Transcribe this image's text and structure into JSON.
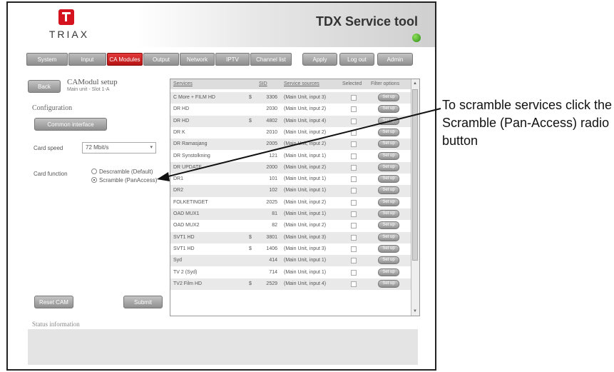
{
  "header": {
    "logo_text": "TRIAX",
    "title": "TDX Service tool"
  },
  "nav": {
    "tabs": [
      {
        "label": "System"
      },
      {
        "label": "Input"
      },
      {
        "label": "CA Modules"
      },
      {
        "label": "Output"
      },
      {
        "label": "Network"
      },
      {
        "label": "IPTV"
      },
      {
        "label": "Channel list"
      }
    ],
    "active_tab": "CA Modules",
    "right_buttons": [
      {
        "label": "Apply"
      },
      {
        "label": "Log out"
      },
      {
        "label": "Admin"
      }
    ]
  },
  "page": {
    "back_label": "Back",
    "title": "CAModul setup",
    "subtitle": "Main unit - Slot 1-A",
    "configuration_heading": "Configuration",
    "common_interface_label": "Common interface",
    "card_speed_label": "Card speed",
    "card_speed_value": "72 Mbit/s",
    "card_function_label": "Card function",
    "radio_descramble": "Descramble (Default)",
    "radio_scramble": "Scramble (PanAccess)",
    "selected_function": "Scramble (PanAccess)",
    "reset_cam_label": "Reset CAM",
    "submit_label": "Submit",
    "status_heading": "Status information"
  },
  "services_table": {
    "headers": [
      "Services",
      "SID",
      "Service sources",
      "Selected",
      "Filter options"
    ],
    "filter_button_label": "Set up",
    "rows": [
      {
        "service": "C More + FILM HD",
        "paid": "$",
        "sid": "3306",
        "source": "(Main Unit, input 3)"
      },
      {
        "service": "DR HD",
        "paid": "",
        "sid": "2030",
        "source": "(Main Unit, input 2)"
      },
      {
        "service": "DR HD",
        "paid": "$",
        "sid": "4802",
        "source": "(Main Unit, input 4)"
      },
      {
        "service": "DR K",
        "paid": "",
        "sid": "2010",
        "source": "(Main Unit, input 2)"
      },
      {
        "service": "DR Ramasjang",
        "paid": "",
        "sid": "2005",
        "source": "(Main Unit, input 2)"
      },
      {
        "service": "DR Synstolkning",
        "paid": "",
        "sid": "121",
        "source": "(Main Unit, input 1)"
      },
      {
        "service": "DR UPDATE",
        "paid": "",
        "sid": "2000",
        "source": "(Main Unit, input 2)"
      },
      {
        "service": "DR1",
        "paid": "",
        "sid": "101",
        "source": "(Main Unit, input 1)"
      },
      {
        "service": "DR2",
        "paid": "",
        "sid": "102",
        "source": "(Main Unit, input 1)"
      },
      {
        "service": "FOLKETINGET",
        "paid": "",
        "sid": "2025",
        "source": "(Main Unit, input 2)"
      },
      {
        "service": "OAD MUX1",
        "paid": "",
        "sid": "81",
        "source": "(Main Unit, input 1)"
      },
      {
        "service": "OAD MUX2",
        "paid": "",
        "sid": "82",
        "source": "(Main Unit, input 2)"
      },
      {
        "service": "SVT1 HD",
        "paid": "$",
        "sid": "3801",
        "source": "(Main Unit, input 3)"
      },
      {
        "service": "SVT1 HD",
        "paid": "$",
        "sid": "1406",
        "source": "(Main Unit, input 3)"
      },
      {
        "service": "Syd",
        "paid": "",
        "sid": "414",
        "source": "(Main Unit, input 1)"
      },
      {
        "service": "TV 2 (Syd)",
        "paid": "",
        "sid": "714",
        "source": "(Main Unit, input 1)"
      },
      {
        "service": "TV2 Film HD",
        "paid": "$",
        "sid": "2529",
        "source": "(Main Unit, input 4)"
      }
    ]
  },
  "annotation": {
    "text": "To scramble services click the Scramble (Pan-Access) radio button"
  },
  "colors": {
    "active_tab": "#c81e1e",
    "status_led": "#3fa51c",
    "logo_red": "#d4131f"
  }
}
